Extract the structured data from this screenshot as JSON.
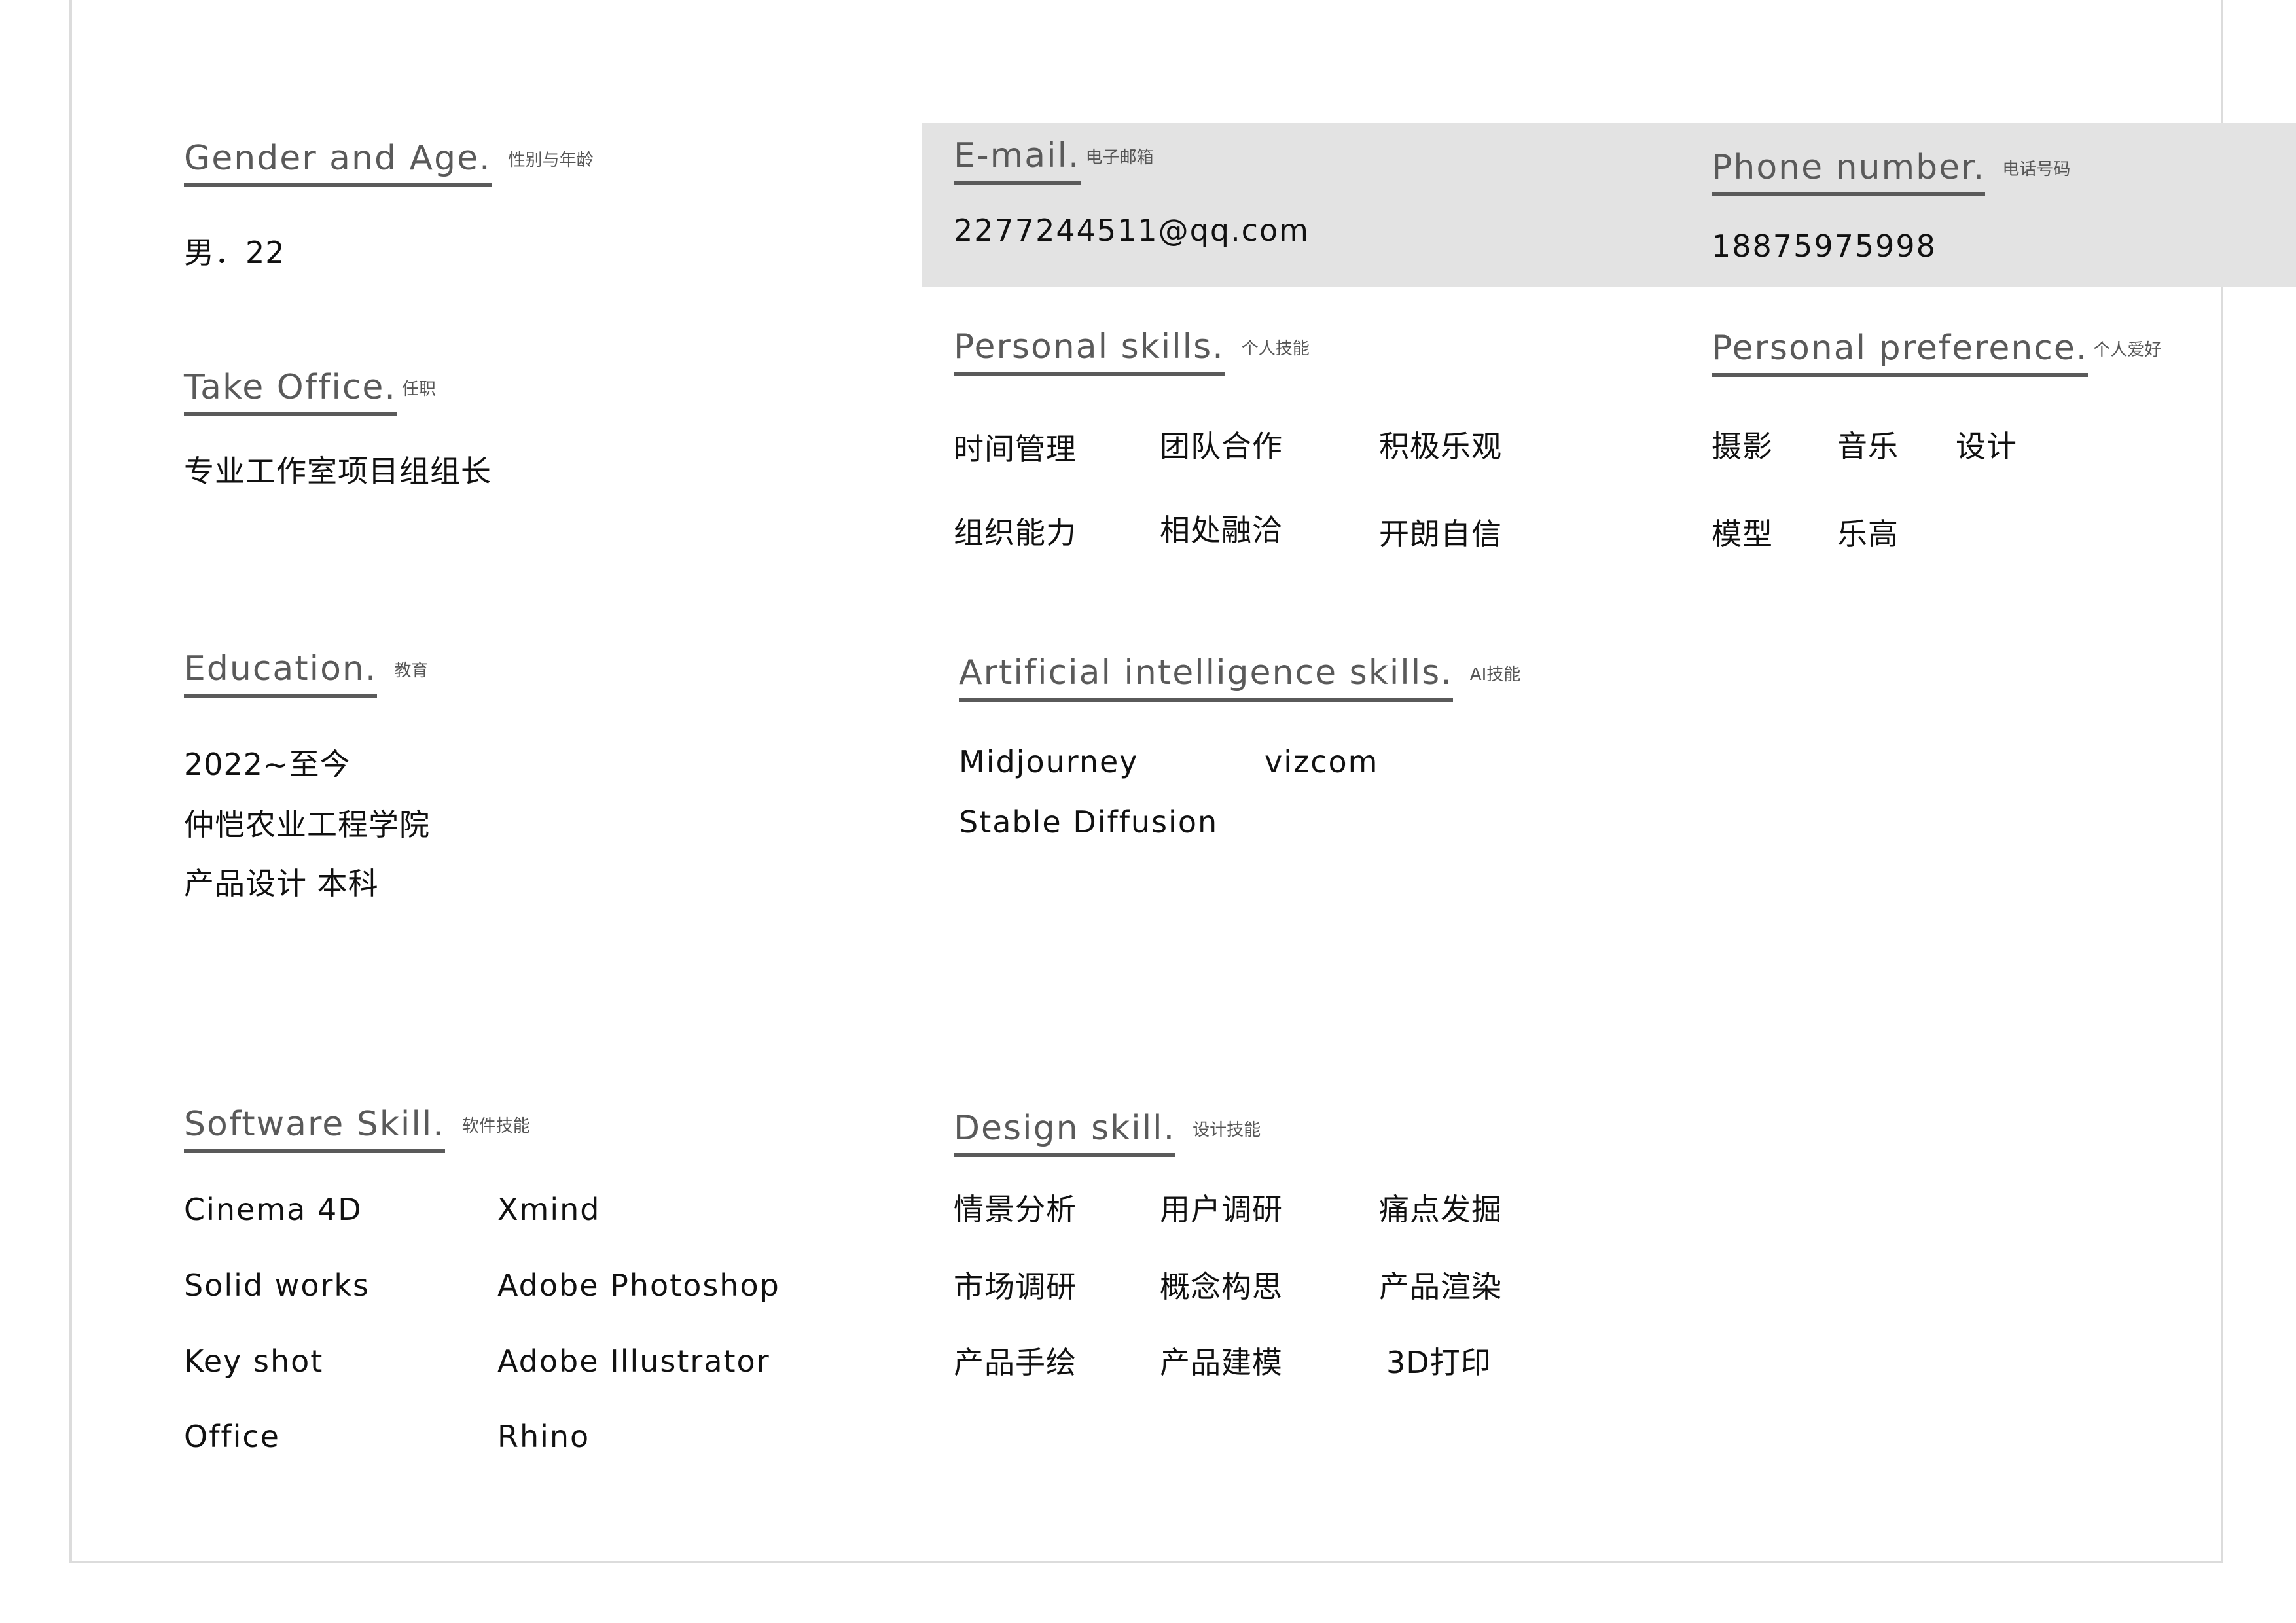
{
  "gender_age": {
    "title": "Gender and Age.",
    "subtitle": "性别与年龄",
    "value": "男．22"
  },
  "take_office": {
    "title": "Take Office.",
    "subtitle": "任职",
    "value": "专业工作室项目组组长"
  },
  "education": {
    "title": "Education.",
    "subtitle": "教育",
    "lines": [
      "2022~至今",
      "仲恺农业工程学院",
      "产品设计 本科"
    ]
  },
  "software": {
    "title": "Software Skill.",
    "subtitle": "软件技能",
    "col1": [
      "Cinema 4D",
      "Solid works",
      "Key shot",
      "Office"
    ],
    "col2": [
      "Xmind",
      "Adobe Photoshop",
      "Adobe Illustrator",
      "Rhino"
    ]
  },
  "email": {
    "title": "E-mail.",
    "subtitle": "电子邮箱",
    "value": "2277244511@qq.com"
  },
  "phone": {
    "title": "Phone number.",
    "subtitle": "电话号码",
    "value": "18875975998"
  },
  "personal_skills": {
    "title": "Personal skills.",
    "subtitle": "个人技能",
    "items": [
      "时间管理",
      "团队合作",
      "积极乐观",
      "组织能力",
      "相处融洽",
      "开朗自信"
    ]
  },
  "personal_preference": {
    "title": "Personal preference.",
    "subtitle": "个人爱好",
    "items": [
      "摄影",
      "音乐",
      "设计",
      "模型",
      "乐高"
    ]
  },
  "ai_skills": {
    "title": "Artificial intelligence skills.",
    "subtitle": "AI技能",
    "items": [
      "Midjourney",
      "vizcom",
      "Stable Diffusion"
    ]
  },
  "design_skill": {
    "title": "Design skill.",
    "subtitle": "设计技能",
    "items": [
      "情景分析",
      "用户调研",
      "痛点发掘",
      "市场调研",
      "概念构思",
      "产品渲染",
      "产品手绘",
      "产品建模",
      "3D打印"
    ]
  }
}
